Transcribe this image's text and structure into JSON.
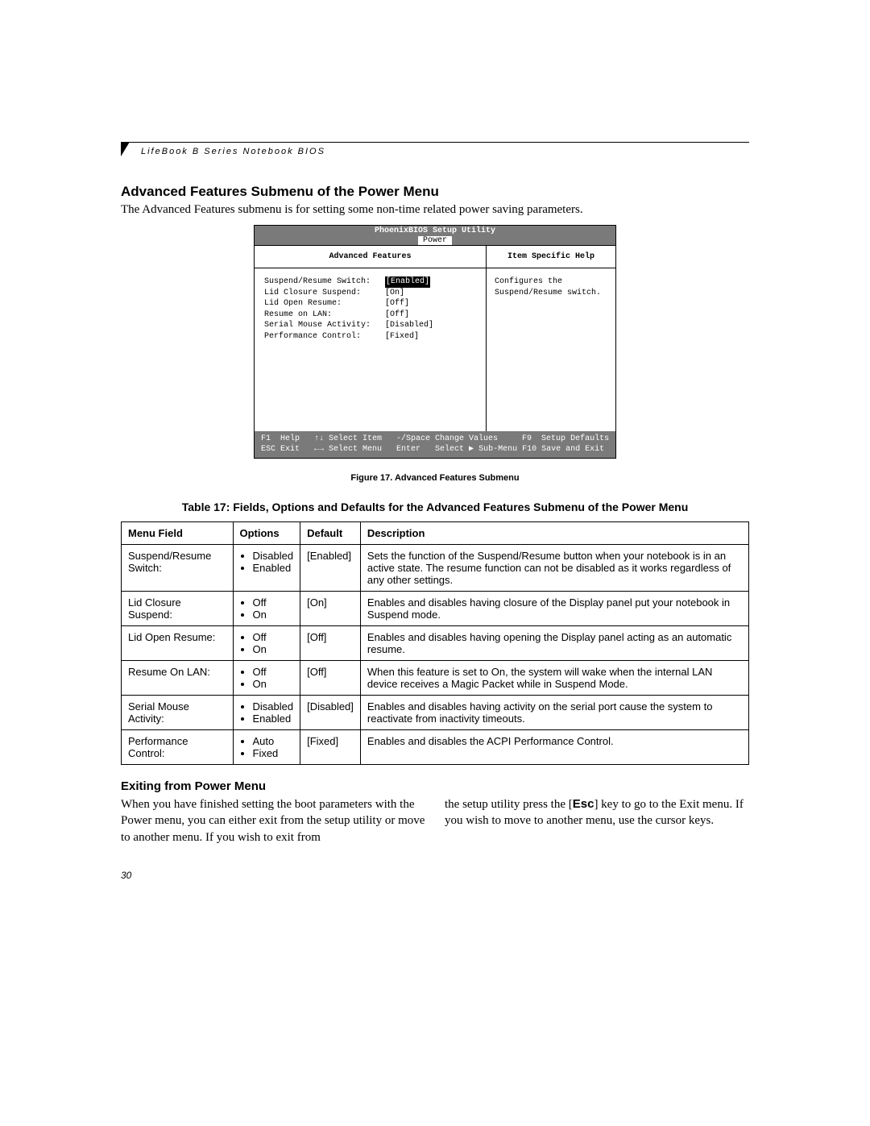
{
  "running_head": "LifeBook B Series Notebook BIOS",
  "section_title": "Advanced Features Submenu of the Power Menu",
  "intro_text": "The Advanced Features submenu is for setting some non-time related power saving parameters.",
  "bios": {
    "app_title": "PhoenixBIOS Setup Utility",
    "active_tab": "Power",
    "left_header": "Advanced Features",
    "right_header": "Item Specific Help",
    "help_text": "Configures the Suspend/Resume switch.",
    "items": [
      {
        "label": "Suspend/Resume Switch:",
        "value": "[Enabled]",
        "selected": true
      },
      {
        "label": "Lid Closure Suspend:",
        "value": "[On]",
        "selected": false
      },
      {
        "label": "Lid Open Resume:",
        "value": "[Off]",
        "selected": false
      },
      {
        "label": "Resume on LAN:",
        "value": "[Off]",
        "selected": false
      },
      {
        "label": "Serial Mouse Activity:",
        "value": "[Disabled]",
        "selected": false
      },
      {
        "label": "Performance Control:",
        "value": "[Fixed]",
        "selected": false
      }
    ],
    "footer": {
      "f1": "F1",
      "f1_label": "Help",
      "updown": "↑↓",
      "updown_label": "Select Item",
      "minus_space": "-/Space",
      "minus_space_label": "Change Values",
      "f9": "F9",
      "f9_label": "Setup Defaults",
      "esc": "ESC",
      "esc_label": "Exit",
      "leftright": "←→",
      "leftright_label": "Select Menu",
      "enter": "Enter",
      "enter_label": "Select ▶ Sub-Menu",
      "f10": "F10",
      "f10_label": "Save and Exit"
    }
  },
  "figure_caption": "Figure 17.  Advanced Features Submenu",
  "table_caption": "Table 17: Fields, Options and Defaults for the Advanced Features Submenu of the Power Menu",
  "table": {
    "headers": [
      "Menu Field",
      "Options",
      "Default",
      "Description"
    ],
    "rows": [
      {
        "field": "Suspend/Resume Switch:",
        "options": [
          "Disabled",
          "Enabled"
        ],
        "default": "[Enabled]",
        "description": "Sets the function of the Suspend/Resume button when your notebook is in an active state. The resume function can not be disabled as it works regardless of any other settings."
      },
      {
        "field": "Lid Closure Suspend:",
        "options": [
          "Off",
          "On"
        ],
        "default": "[On]",
        "description": "Enables and disables having closure of the Display panel put your notebook in Suspend mode."
      },
      {
        "field": "Lid Open Resume:",
        "options": [
          "Off",
          "On"
        ],
        "default": "[Off]",
        "description": "Enables and disables having opening the Display panel acting as an automatic resume."
      },
      {
        "field": "Resume On LAN:",
        "options": [
          "Off",
          "On"
        ],
        "default": "[Off]",
        "description": "When this feature is set to On, the system will wake when the internal LAN device receives a Magic Packet while in Suspend Mode."
      },
      {
        "field": "Serial Mouse Activity:",
        "options": [
          "Disabled",
          "Enabled"
        ],
        "default": "[Disabled]",
        "description": "Enables and disables having activity on the serial port cause the system to reactivate from inactivity timeouts."
      },
      {
        "field": "Performance Control:",
        "options": [
          "Auto",
          "Fixed"
        ],
        "default": "[Fixed]",
        "description": "Enables and disables the ACPI Performance Control."
      }
    ]
  },
  "exit_heading": "Exiting from Power Menu",
  "exit_col1": "When you have finished setting the boot parameters with the Power menu, you can either exit from the setup utility or move to another menu. If you wish to exit from",
  "exit_col2_a": "the setup utility press the [",
  "exit_col2_key": "Esc",
  "exit_col2_b": "] key to go to the Exit menu. If you wish to move to another menu, use the cursor keys.",
  "page_number": "30"
}
